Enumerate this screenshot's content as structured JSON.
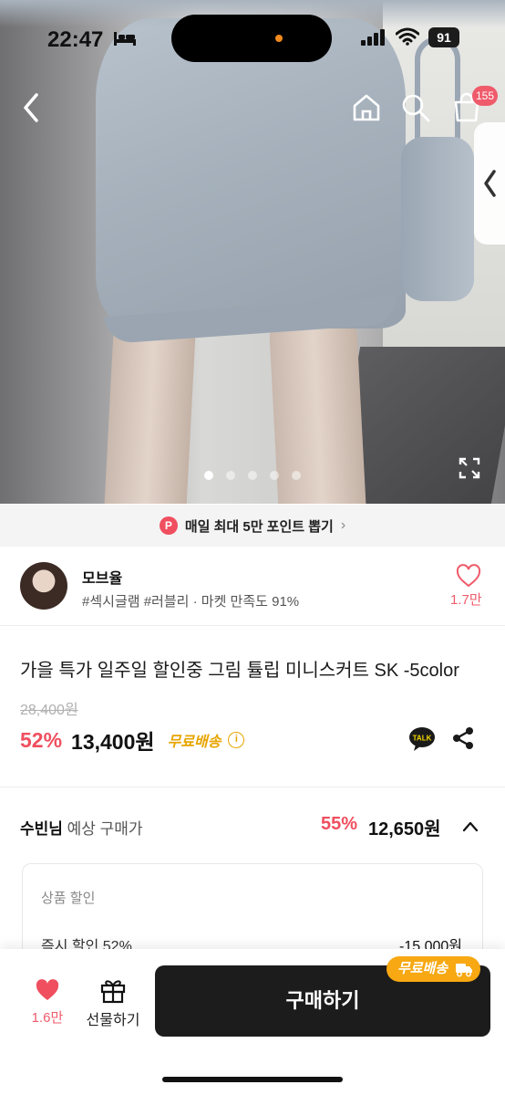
{
  "status_bar": {
    "time": "22:47",
    "battery": "91"
  },
  "header": {
    "cart_count": "155"
  },
  "gallery": {
    "total_images": 5,
    "active_index": 0
  },
  "point_banner": {
    "badge": "P",
    "text": "매일 최대 5만 포인트 뽑기",
    "chevron": "›"
  },
  "seller": {
    "name": "모브율",
    "sub": "#섹시글램 #러블리 · 마켓 만족도 91%",
    "likes": "1.7만"
  },
  "product": {
    "title": "가을 특가 일주일 할인중 그림 튤립 미니스커트 SK -5color",
    "original_price": "28,400원",
    "discount": "52%",
    "price": "13,400원",
    "shipping": "무료배송",
    "info_icon": "i"
  },
  "expected": {
    "user": "수빈님",
    "label": " 예상 구매가",
    "discount": "55%",
    "price": "12,650원"
  },
  "detail": {
    "heading": "상품 할인",
    "row_label": "즉시 할인 52%",
    "row_value": "-15,000원"
  },
  "bottom_bar": {
    "wish_count": "1.6만",
    "gift_label": "선물하기",
    "buy_label": "구매하기",
    "free_shipping_tag": "무료배송"
  },
  "colors": {
    "accent": "#ef4f5f",
    "shipping": "#e7a500",
    "buy_button": "#1c1c1c"
  }
}
